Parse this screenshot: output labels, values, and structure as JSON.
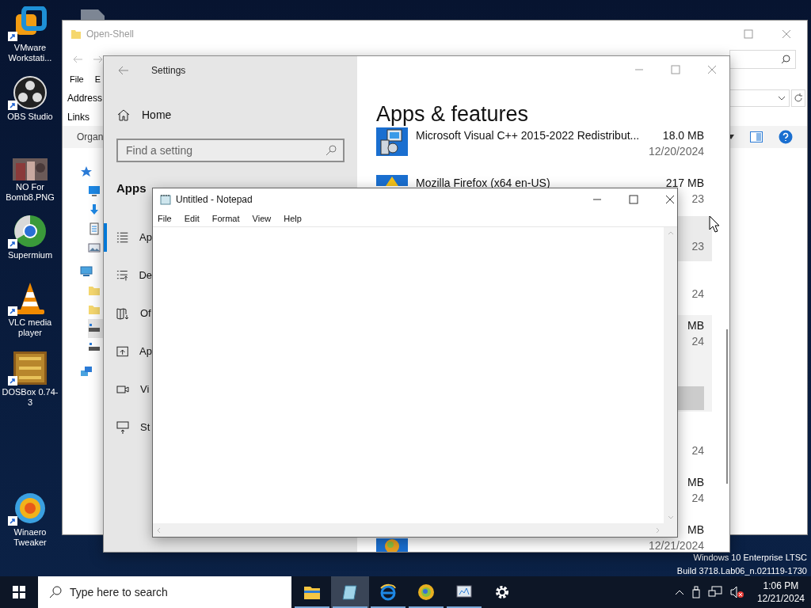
{
  "desktop_icons": [
    {
      "kind": "vmware",
      "label": "VMware Workstati..."
    },
    {
      "kind": "obs",
      "label": "OBS Studio"
    },
    {
      "label": "NO For Bomb8.PNG"
    },
    {
      "kind": "supermium",
      "label": "Supermium"
    },
    {
      "kind": "vlc",
      "label": "VLC media player"
    },
    {
      "kind": "dosbox",
      "label": "DOSBox 0.74-3"
    },
    {
      "kind": "winaero",
      "label": "Winaero Tweaker"
    }
  ],
  "explorer": {
    "title": "Open-Shell",
    "menu": [
      "File",
      "E"
    ],
    "address_label": "Address",
    "links_label": "Links",
    "toolbar_label": "Organ",
    "tree": [
      {
        "kind": "star",
        "selected": false,
        "children": [
          {
            "kind": "desktop",
            "selected": false
          },
          {
            "kind": "download",
            "selected": false
          },
          {
            "kind": "document",
            "selected": false
          },
          {
            "kind": "pictures",
            "selected": false
          }
        ]
      },
      {
        "kind": "computer",
        "selected": false,
        "children": [
          {
            "kind": "folder",
            "selected": false
          },
          {
            "kind": "folder",
            "selected": false
          },
          {
            "kind": "drive",
            "selected": true
          },
          {
            "kind": "drive",
            "selected": false
          }
        ]
      },
      {
        "kind": "network",
        "selected": false
      }
    ]
  },
  "settings": {
    "title": "Settings",
    "home": "Home",
    "search_placeholder": "Find a setting",
    "section": "Apps",
    "nav": [
      {
        "kind": "list",
        "label": "Ap",
        "selected": true
      },
      {
        "kind": "defaults",
        "label": "De",
        "selected": false
      },
      {
        "kind": "map",
        "label": "Of",
        "selected": false
      },
      {
        "kind": "website",
        "label": "Ap",
        "selected": false
      },
      {
        "kind": "video",
        "label": "Vi",
        "selected": false
      },
      {
        "kind": "startup",
        "label": "St",
        "selected": false
      }
    ],
    "heading": "Apps & features",
    "apps": [
      {
        "kind": "installer",
        "name": "Microsoft Visual C++ 2015-2022 Redistribut...",
        "size": "18.0 MB",
        "date": "12/20/2024",
        "selected": false,
        "hovered": false
      },
      {
        "kind": "firefox",
        "name": "Mozilla Firefox (x64 en-US)",
        "size": "217 MB",
        "date": "23",
        "selected": false,
        "hovered": false
      },
      {
        "date": "23",
        "selected": false,
        "hovered": true
      },
      {
        "date": "24",
        "selected": false,
        "hovered": false
      },
      {
        "size": "MB",
        "date": "24",
        "selected": true,
        "hovered": false
      },
      {
        "date": "24",
        "selected": false,
        "hovered": false
      },
      {
        "size": "MB",
        "date": "24",
        "selected": false,
        "hovered": false
      },
      {
        "kind": "orange-app",
        "size": "MB",
        "date": "12/21/2024",
        "selected": false,
        "hovered": false
      }
    ]
  },
  "notepad": {
    "title": "Untitled - Notepad",
    "menu": [
      "File",
      "Edit",
      "Format",
      "View",
      "Help"
    ]
  },
  "os_build": [
    "Windows 10 Enterprise LTSC",
    "Build 3718.Lab06_n.021119-1730"
  ],
  "taskbar": {
    "search_placeholder": "Type here to search",
    "apps": [
      {
        "kind": "explorer",
        "selected": false,
        "running": true
      },
      {
        "kind": "notepad",
        "selected": true,
        "running": true
      },
      {
        "kind": "ie",
        "selected": false,
        "running": true
      },
      {
        "kind": "supermium",
        "selected": false,
        "running": true
      },
      {
        "kind": "control-panel",
        "selected": false,
        "running": true
      },
      {
        "kind": "settings",
        "selected": false,
        "running": false
      }
    ],
    "time": "1:06 PM",
    "date": "12/21/2024"
  }
}
